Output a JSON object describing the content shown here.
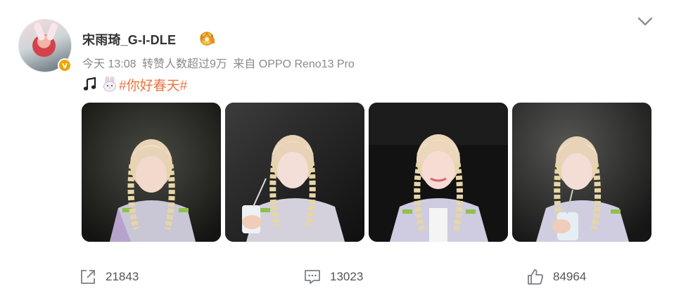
{
  "post": {
    "username": "宋雨琦_G-I-DLE",
    "meta": {
      "time": "今天 13:08",
      "reposts_info": "转赞人数超过9万",
      "source": "来自 OPPO Reno13 Pro"
    },
    "text": {
      "hashtag": "#你好春天#"
    },
    "icons": {
      "note": "music-note-icon",
      "bunny": "bunny-emoji-icon",
      "crown": "crown-badge-icon",
      "more": "chevron-down-icon"
    },
    "images": [
      {
        "name": "photo-1"
      },
      {
        "name": "photo-2"
      },
      {
        "name": "photo-3"
      },
      {
        "name": "photo-4"
      }
    ],
    "actions": {
      "share_count": "21843",
      "comment_count": "13023",
      "like_count": "84964"
    },
    "colors": {
      "hashtag": "#eb7340",
      "meta": "#8a8a8a",
      "verified": "#f0a400"
    }
  }
}
